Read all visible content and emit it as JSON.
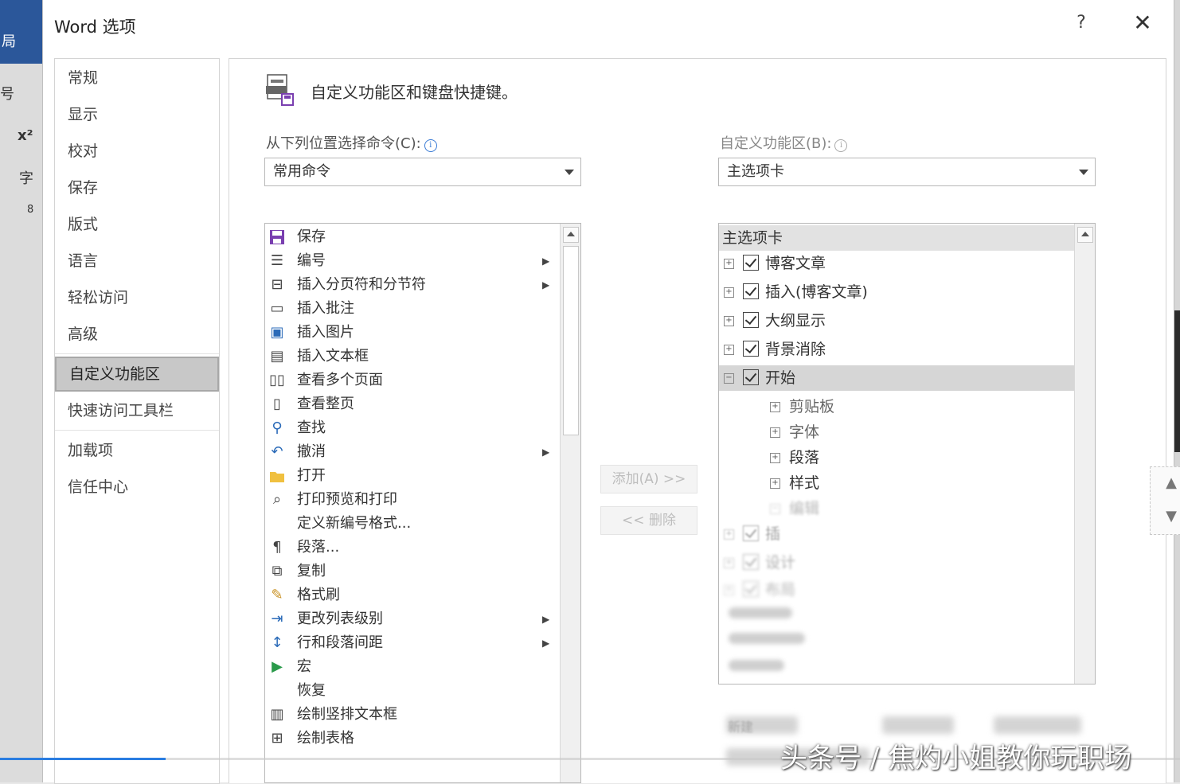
{
  "background_app": {
    "tab_fragment": "局",
    "fragment_1": "号",
    "fragment_2": "x²",
    "fragment_3": "字",
    "fragment_4": "8"
  },
  "dialog": {
    "title": "Word 选项",
    "help": "?",
    "close": "✕"
  },
  "nav": {
    "items": [
      "常规",
      "显示",
      "校对",
      "保存",
      "版式",
      "语言",
      "轻松访问",
      "高级",
      "自定义功能区",
      "快速访问工具栏",
      "加载项",
      "信任中心"
    ],
    "active": "自定义功能区"
  },
  "header": {
    "text": "自定义功能区和键盘快捷键。"
  },
  "commands": {
    "label": "从下列位置选择命令(C):",
    "selected": "常用命令",
    "items": [
      {
        "icon": "save-icon",
        "label": "保存"
      },
      {
        "icon": "numbering-icon",
        "label": "编号"
      },
      {
        "icon": "page-break-icon",
        "label": "插入分页符和分节符"
      },
      {
        "icon": "comment-icon",
        "label": "插入批注"
      },
      {
        "icon": "picture-icon",
        "label": "插入图片"
      },
      {
        "icon": "textbox-icon",
        "label": "插入文本框"
      },
      {
        "icon": "multi-page-icon",
        "label": "查看多个页面"
      },
      {
        "icon": "whole-page-icon",
        "label": "查看整页"
      },
      {
        "icon": "find-icon",
        "label": "查找"
      },
      {
        "icon": "undo-icon",
        "label": "撤消"
      },
      {
        "icon": "open-folder-icon",
        "label": "打开"
      },
      {
        "icon": "print-preview-icon",
        "label": "打印预览和打印"
      },
      {
        "icon": "none",
        "label": "定义新编号格式..."
      },
      {
        "icon": "paragraph-icon",
        "label": "段落..."
      },
      {
        "icon": "copy-icon",
        "label": "复制"
      },
      {
        "icon": "format-painter-icon",
        "label": "格式刷"
      },
      {
        "icon": "list-level-icon",
        "label": "更改列表级别"
      },
      {
        "icon": "line-spacing-icon",
        "label": "行和段落间距"
      },
      {
        "icon": "macro-icon",
        "label": "宏"
      },
      {
        "icon": "none",
        "label": "恢复"
      },
      {
        "icon": "draw-textbox-icon",
        "label": "绘制竖排文本框"
      },
      {
        "icon": "draw-table-icon",
        "label": "绘制表格"
      }
    ]
  },
  "ribbon": {
    "label": "自定义功能区(B):",
    "selected": "主选项卡",
    "tree_header": "主选项卡",
    "tabs": [
      {
        "label": "博客文章",
        "level": 0,
        "expand": "+"
      },
      {
        "label": "插入(博客文章)",
        "level": 0,
        "expand": "+"
      },
      {
        "label": "大纲显示",
        "level": 0,
        "expand": "+"
      },
      {
        "label": "背景消除",
        "level": 0,
        "expand": "+"
      },
      {
        "label": "开始",
        "level": 0,
        "expand": "−"
      },
      {
        "label": "剪贴板",
        "level": 1,
        "expand": "+"
      },
      {
        "label": "字体",
        "level": 1,
        "expand": "+"
      },
      {
        "label": "段落",
        "level": 1,
        "expand": "+"
      },
      {
        "label": "样式",
        "level": 1,
        "expand": "+"
      },
      {
        "label": "编辑",
        "level": 1,
        "expand": "−"
      },
      {
        "label": "插",
        "level": 0,
        "expand": "+"
      },
      {
        "label": "设计",
        "level": 0,
        "expand": "+"
      },
      {
        "label": "布局",
        "level": 0,
        "expand": "+"
      }
    ]
  },
  "buttons": {
    "add": "添加(A) >>",
    "remove": "<< 删除"
  },
  "footer": {
    "new_label": "新建"
  },
  "watermark": "头条号 / 焦灼小姐教你玩职场"
}
